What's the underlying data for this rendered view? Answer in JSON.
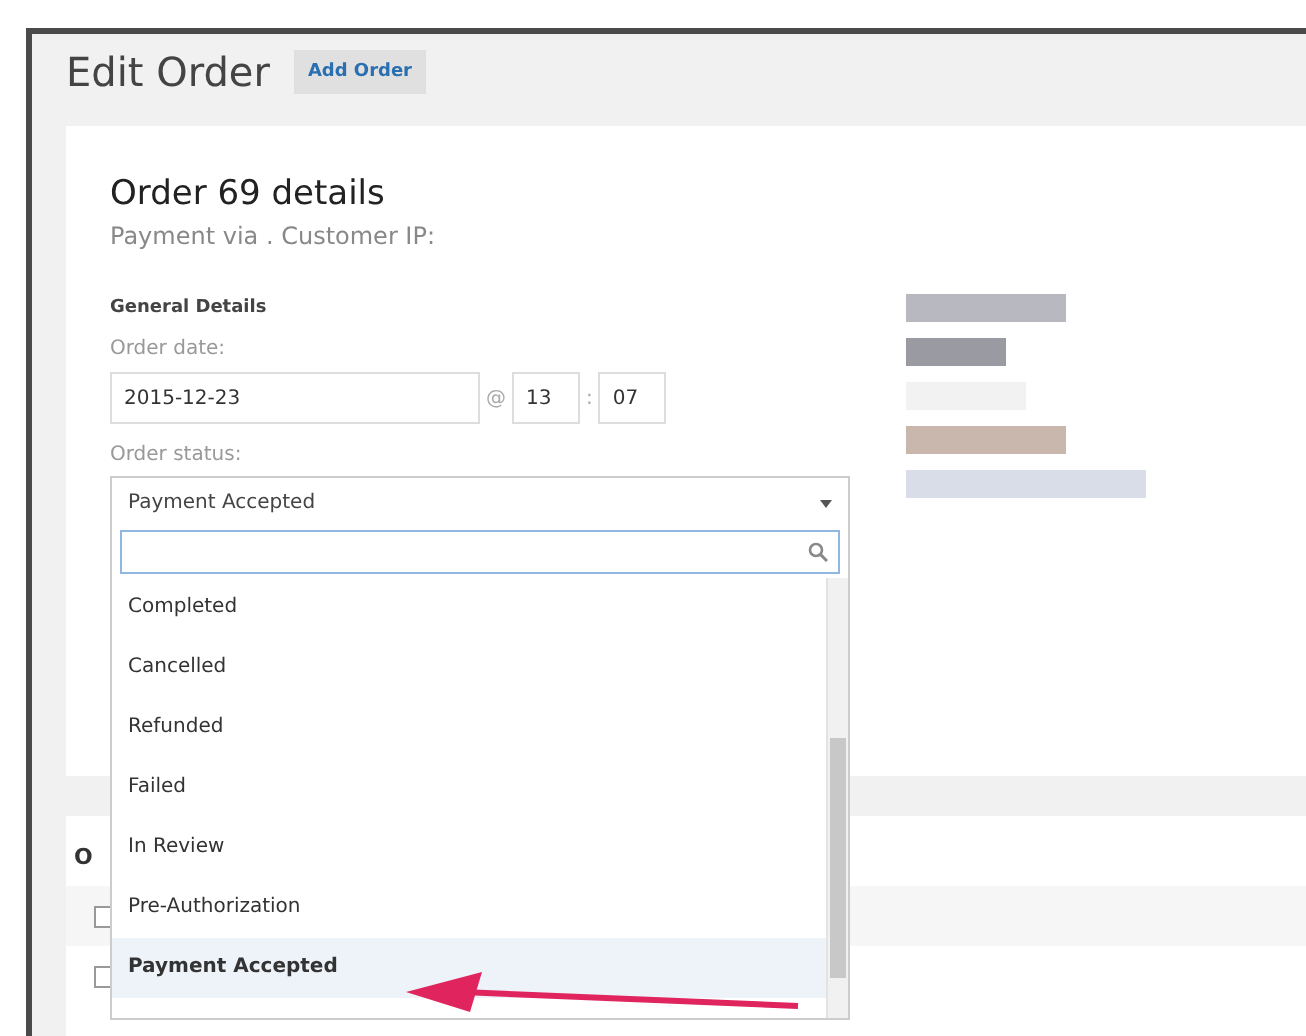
{
  "header": {
    "title": "Edit Order",
    "add_button": "Add Order"
  },
  "order": {
    "title": "Order 69 details",
    "subtitle": "Payment via . Customer IP:",
    "section": "General Details",
    "date_label": "Order date:",
    "date": "2015-12-23",
    "at": "@",
    "hour": "13",
    "colon": ":",
    "minute": "07",
    "status_label": "Order status:",
    "status": "Payment Accepted",
    "dropdown_open": true,
    "options": [
      {
        "label": "Completed",
        "selected": false
      },
      {
        "label": "Cancelled",
        "selected": false
      },
      {
        "label": "Refunded",
        "selected": false
      },
      {
        "label": "Failed",
        "selected": false
      },
      {
        "label": "In Review",
        "selected": false
      },
      {
        "label": "Pre-Authorization",
        "selected": false
      },
      {
        "label": "Payment Accepted",
        "selected": true
      }
    ]
  },
  "items_panel": {
    "heading": "O",
    "rows": [
      {
        "checked": false
      },
      {
        "checked": false
      }
    ]
  }
}
